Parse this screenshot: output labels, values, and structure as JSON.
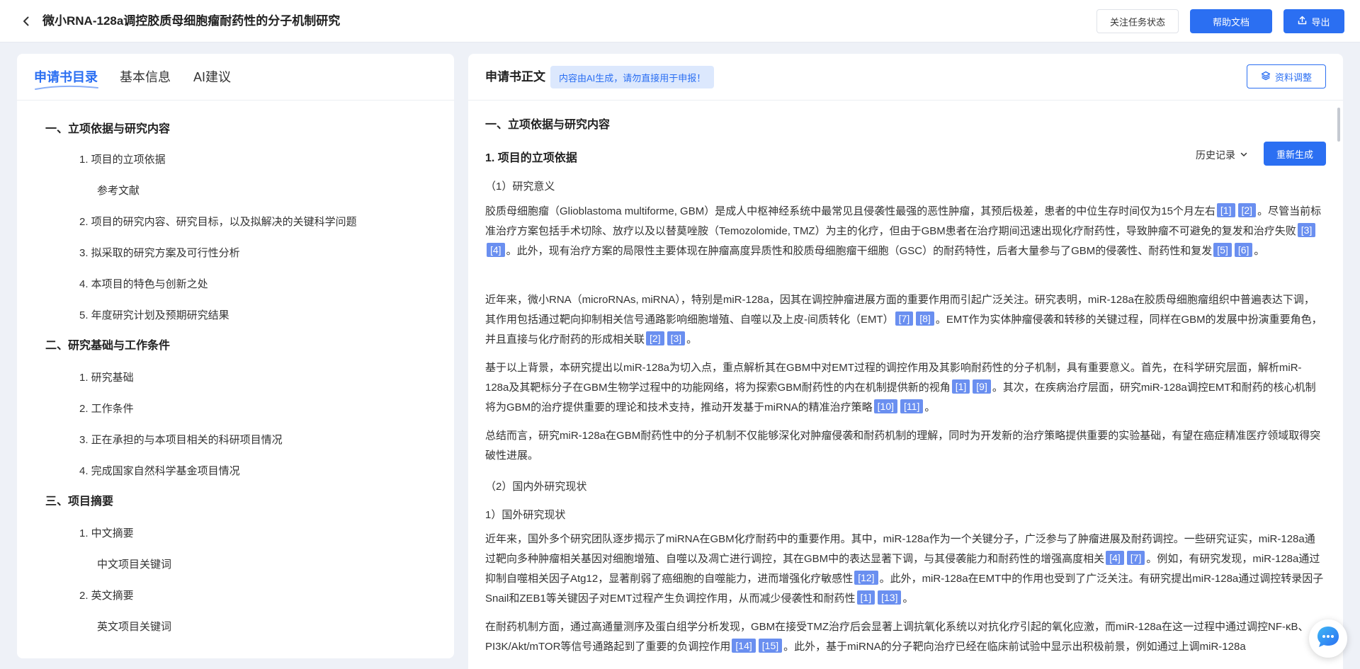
{
  "header": {
    "title": "微小RNA-128a调控胶质母细胞瘤耐药性的分子机制研究",
    "follow_label": "关注任务状态",
    "help_label": "帮助文档",
    "export_label": "导出"
  },
  "left": {
    "tabs": [
      {
        "label": "申请书目录"
      },
      {
        "label": "基本信息"
      },
      {
        "label": "AI建议"
      }
    ],
    "toc": [
      {
        "label": "一、立项依据与研究内容"
      },
      {
        "label": "1. 项目的立项依据"
      },
      {
        "label": "参考文献"
      },
      {
        "label": "2. 项目的研究内容、研究目标，以及拟解决的关键科学问题"
      },
      {
        "label": "3. 拟采取的研究方案及可行性分析"
      },
      {
        "label": "4. 本项目的特色与创新之处"
      },
      {
        "label": "5. 年度研究计划及预期研究结果"
      },
      {
        "label": "二、研究基础与工作条件"
      },
      {
        "label": "1. 研究基础"
      },
      {
        "label": "2. 工作条件"
      },
      {
        "label": "3. 正在承担的与本项目相关的科研项目情况"
      },
      {
        "label": "4. 完成国家自然科学基金项目情况"
      },
      {
        "label": "三、项目摘要"
      },
      {
        "label": "1. 中文摘要"
      },
      {
        "label": "中文项目关键词"
      },
      {
        "label": "2. 英文摘要"
      },
      {
        "label": "英文项目关键词"
      }
    ]
  },
  "right": {
    "title": "申请书正文",
    "ai_note": "内容由AI生成，请勿直接用于申报！",
    "adjust_label": "资料调整",
    "section_title": "一、立项依据与研究内容",
    "subsection_title": "1. 项目的立项依据",
    "history_label": "历史记录",
    "regen_label": "重新生成",
    "h_significance": "（1）研究意义",
    "h_status": "（2）国内外研究现状",
    "h_foreign": "1）国外研究现状",
    "p1": {
      "a": "胶质母细胞瘤（Glioblastoma multiforme, GBM）是成人中枢神经系统中最常见且侵袭性最强的恶性肿瘤，其预后极差，患者的中位生存时间仅为15个月左右",
      "r1": "[1]",
      "r2": "[2]",
      "b": "。尽管当前标准治疗方案包括手术切除、放疗以及以替莫唑胺（Temozolomide, TMZ）为主的化疗，但由于GBM患者在治疗期间迅速出现化疗耐药性，导致肿瘤不可避免的复发和治疗失败",
      "r3": "[3]",
      "r4": "[4]",
      "c": "。此外，现有治疗方案的局限性主要体现在肿瘤高度异质性和胶质母细胞瘤干细胞（GSC）的耐药特性，后者大量参与了GBM的侵袭性、耐药性和复发",
      "r5": "[5]",
      "r6": "[6]",
      "d": "。"
    },
    "p2": {
      "a": "近年来，微小RNA（microRNAs, miRNA），特别是miR-128a，因其在调控肿瘤进展方面的重要作用而引起广泛关注。研究表明，miR-128a在胶质母细胞瘤组织中普遍表达下调，其作用包括通过靶向抑制相关信号通路影响细胞增殖、自噬以及上皮-间质转化（EMT）",
      "r7": "[7]",
      "r8": "[8]",
      "b": "。EMT作为实体肿瘤侵袭和转移的关键过程，同样在GBM的发展中扮演重要角色，并且直接与化疗耐药的形成相关联",
      "r2": "[2]",
      "r3": "[3]",
      "c": "。"
    },
    "p3": {
      "a": "基于以上背景，本研究提出以miR-128a为切入点，重点解析其在GBM中对EMT过程的调控作用及其影响耐药性的分子机制，具有重要意义。首先，在科学研究层面，解析miR-128a及其靶标分子在GBM生物学过程中的功能网络，将为探索GBM耐药性的内在机制提供新的视角",
      "r1": "[1]",
      "r9": "[9]",
      "b": "。其次，在疾病治疗层面，研究miR-128a调控EMT和耐药的核心机制将为GBM的治疗提供重要的理论和技术支持，推动开发基于miRNA的精准治疗策略",
      "r10": "[10]",
      "r11": "[11]",
      "c": "。"
    },
    "p4": "总结而言，研究miR-128a在GBM耐药性中的分子机制不仅能够深化对肿瘤侵袭和耐药机制的理解，同时为开发新的治疗策略提供重要的实验基础，有望在癌症精准医疗领域取得突破性进展。",
    "p5": {
      "a": "近年来，国外多个研究团队逐步揭示了miRNA在GBM化疗耐药中的重要作用。其中，miR-128a作为一个关键分子，广泛参与了肿瘤进展及耐药调控。一些研究证实，miR-128a通过靶向多种肿瘤相关基因对细胞增殖、自噬以及凋亡进行调控，其在GBM中的表达显著下调，与其侵袭能力和耐药性的增强高度相关",
      "r4": "[4]",
      "r7": "[7]",
      "b": "。例如，有研究发现，miR-128a通过抑制自噬相关因子Atg12，显著削弱了癌细胞的自噬能力，进而增强化疗敏感性",
      "r12": "[12]",
      "c": "。此外，miR-128a在EMT中的作用也受到了广泛关注。有研究提出miR-128a通过调控转录因子Snail和ZEB1等关键因子对EMT过程产生负调控作用，从而减少侵袭性和耐药性",
      "r1": "[1]",
      "r13": "[13]",
      "d": "。"
    },
    "p6": {
      "a": "在耐药机制方面，通过高通量测序及蛋白组学分析发现，GBM在接受TMZ治疗后会显著上调抗氧化系统以对抗化疗引起的氧化应激，而miR-128a在这一过程中通过调控NF-κB、PI3K/Akt/mTOR等信号通路起到了重要的负调控作用",
      "r14": "[14]",
      "r15": "[15]",
      "b": "。此外，基于miRNA的分子靶向治疗已经在临床前试验中显示出积极前景，例如通过上调miR-128a"
    }
  },
  "colors": {
    "accent": "#2b6ff2",
    "ref_badge": "#6a8ff0",
    "note_bg": "#dce8fd"
  }
}
